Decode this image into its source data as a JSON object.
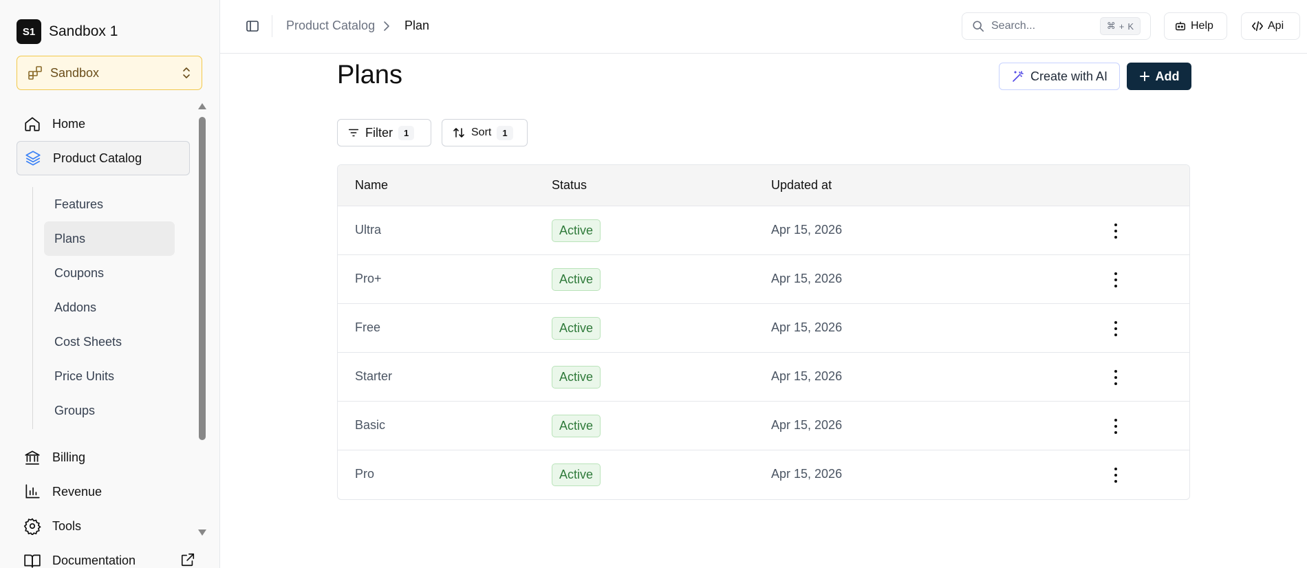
{
  "sidebar": {
    "workspace": {
      "logo_text": "S1",
      "name": "Sandbox 1"
    },
    "environment": {
      "label": "Sandbox"
    },
    "nav": {
      "home": "Home",
      "product_catalog": "Product Catalog",
      "billing": "Billing",
      "revenue": "Revenue",
      "tools": "Tools",
      "documentation": "Documentation"
    },
    "sub_items": [
      "Features",
      "Plans",
      "Coupons",
      "Addons",
      "Cost Sheets",
      "Price Units",
      "Groups"
    ],
    "selected_sub_item": "Plans"
  },
  "header": {
    "breadcrumb": [
      "Product Catalog",
      "Plan"
    ],
    "search_placeholder": "Search...",
    "search_shortcut": {
      "key1": "⌘",
      "plus": "+",
      "key2": "K"
    },
    "help_label": "Help",
    "api_label": "Api"
  },
  "page": {
    "title": "Plans",
    "create_ai_label": "Create with AI",
    "add_label": "Add",
    "filter": {
      "label": "Filter",
      "count": "1"
    },
    "sort": {
      "label": "Sort",
      "count": "1"
    }
  },
  "table": {
    "columns": [
      "Name",
      "Status",
      "Updated at"
    ],
    "rows": [
      {
        "name": "Ultra",
        "status": "Active",
        "updated": "Apr 15, 2026"
      },
      {
        "name": "Pro+",
        "status": "Active",
        "updated": "Apr 15, 2026"
      },
      {
        "name": "Free",
        "status": "Active",
        "updated": "Apr 15, 2026"
      },
      {
        "name": "Starter",
        "status": "Active",
        "updated": "Apr 15, 2026"
      },
      {
        "name": "Basic",
        "status": "Active",
        "updated": "Apr 15, 2026"
      },
      {
        "name": "Pro",
        "status": "Active",
        "updated": "Apr 15, 2026"
      }
    ]
  },
  "colors": {
    "accent_dark": "#0f2a3f",
    "environment_bg": "#fff8e5",
    "environment_border": "#f2c94c",
    "active_badge_bg": "#eaf7ea",
    "active_badge_text": "#2f7a3a",
    "product_catalog_icon": "#3b82f6"
  },
  "icons": {
    "home": "home-icon",
    "product_catalog": "layers-icon",
    "billing": "bank-icon",
    "revenue": "bar-chart-icon",
    "tools": "gear-icon",
    "documentation": "book-icon",
    "external": "external-link-icon",
    "search": "search-icon",
    "help": "bot-icon",
    "api": "code-icon",
    "ai": "magic-wand-icon",
    "filter": "filter-icon",
    "sort": "sort-icon",
    "row_menu": "more-vertical-icon"
  }
}
